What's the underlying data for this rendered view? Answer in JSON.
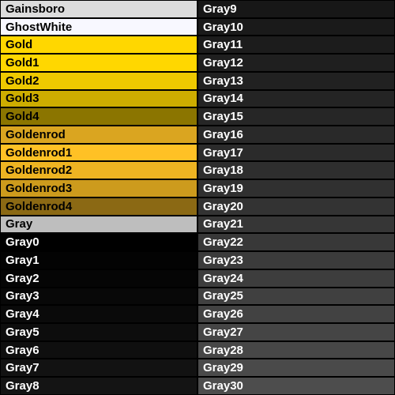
{
  "columns": [
    {
      "swatches": [
        {
          "name": "Gainsboro",
          "hex": "#DCDCDC",
          "text": "dark"
        },
        {
          "name": "GhostWhite",
          "hex": "#F8F8FF",
          "text": "dark"
        },
        {
          "name": "Gold",
          "hex": "#FFD700",
          "text": "dark"
        },
        {
          "name": "Gold1",
          "hex": "#FFD700",
          "text": "dark"
        },
        {
          "name": "Gold2",
          "hex": "#EEC900",
          "text": "dark"
        },
        {
          "name": "Gold3",
          "hex": "#CDAD00",
          "text": "dark"
        },
        {
          "name": "Gold4",
          "hex": "#8B7500",
          "text": "dark"
        },
        {
          "name": "Goldenrod",
          "hex": "#DAA520",
          "text": "dark"
        },
        {
          "name": "Goldenrod1",
          "hex": "#FFC125",
          "text": "dark"
        },
        {
          "name": "Goldenrod2",
          "hex": "#EEB422",
          "text": "dark"
        },
        {
          "name": "Goldenrod3",
          "hex": "#CD9B1D",
          "text": "dark"
        },
        {
          "name": "Goldenrod4",
          "hex": "#8B6914",
          "text": "dark"
        },
        {
          "name": "Gray",
          "hex": "#BEBEBE",
          "text": "dark"
        },
        {
          "name": "Gray0",
          "hex": "#000000",
          "text": "light"
        },
        {
          "name": "Gray1",
          "hex": "#030303",
          "text": "light"
        },
        {
          "name": "Gray2",
          "hex": "#050505",
          "text": "light"
        },
        {
          "name": "Gray3",
          "hex": "#080808",
          "text": "light"
        },
        {
          "name": "Gray4",
          "hex": "#0A0A0A",
          "text": "light"
        },
        {
          "name": "Gray5",
          "hex": "#0D0D0D",
          "text": "light"
        },
        {
          "name": "Gray6",
          "hex": "#0F0F0F",
          "text": "light"
        },
        {
          "name": "Gray7",
          "hex": "#121212",
          "text": "light"
        },
        {
          "name": "Gray8",
          "hex": "#141414",
          "text": "light"
        }
      ]
    },
    {
      "swatches": [
        {
          "name": "Gray9",
          "hex": "#171717",
          "text": "light"
        },
        {
          "name": "Gray10",
          "hex": "#1A1A1A",
          "text": "light"
        },
        {
          "name": "Gray11",
          "hex": "#1C1C1C",
          "text": "light"
        },
        {
          "name": "Gray12",
          "hex": "#1F1F1F",
          "text": "light"
        },
        {
          "name": "Gray13",
          "hex": "#212121",
          "text": "light"
        },
        {
          "name": "Gray14",
          "hex": "#242424",
          "text": "light"
        },
        {
          "name": "Gray15",
          "hex": "#262626",
          "text": "light"
        },
        {
          "name": "Gray16",
          "hex": "#292929",
          "text": "light"
        },
        {
          "name": "Gray17",
          "hex": "#2B2B2B",
          "text": "light"
        },
        {
          "name": "Gray18",
          "hex": "#2E2E2E",
          "text": "light"
        },
        {
          "name": "Gray19",
          "hex": "#303030",
          "text": "light"
        },
        {
          "name": "Gray20",
          "hex": "#333333",
          "text": "light"
        },
        {
          "name": "Gray21",
          "hex": "#363636",
          "text": "light"
        },
        {
          "name": "Gray22",
          "hex": "#383838",
          "text": "light"
        },
        {
          "name": "Gray23",
          "hex": "#3B3B3B",
          "text": "light"
        },
        {
          "name": "Gray24",
          "hex": "#3D3D3D",
          "text": "light"
        },
        {
          "name": "Gray25",
          "hex": "#404040",
          "text": "light"
        },
        {
          "name": "Gray26",
          "hex": "#424242",
          "text": "light"
        },
        {
          "name": "Gray27",
          "hex": "#454545",
          "text": "light"
        },
        {
          "name": "Gray28",
          "hex": "#474747",
          "text": "light"
        },
        {
          "name": "Gray29",
          "hex": "#4A4A4A",
          "text": "light"
        },
        {
          "name": "Gray30",
          "hex": "#4D4D4D",
          "text": "light"
        }
      ]
    }
  ]
}
